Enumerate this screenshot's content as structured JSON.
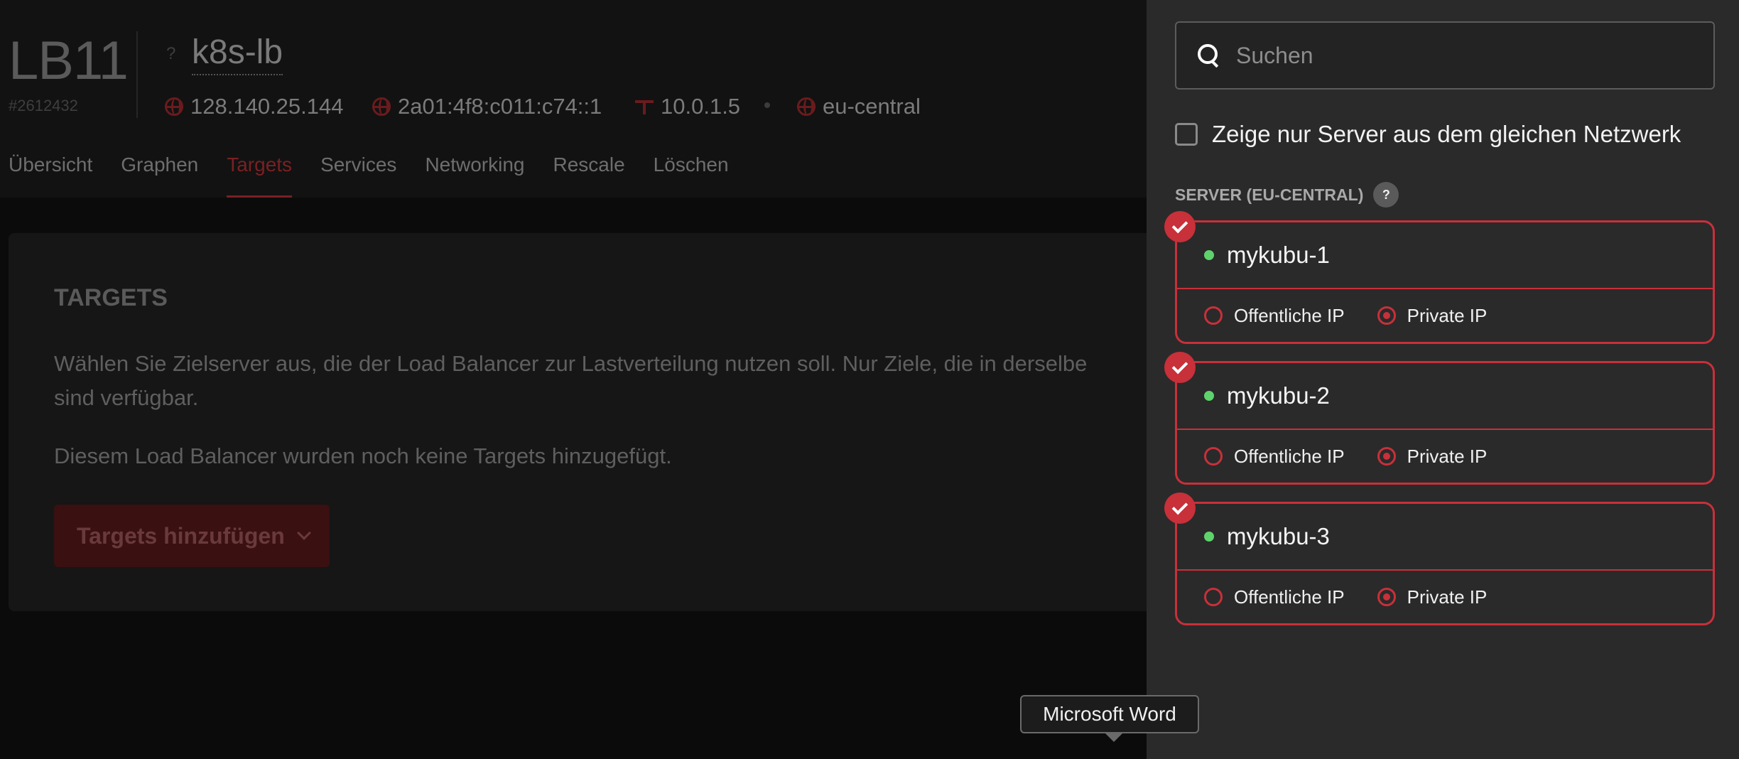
{
  "load_balancer": {
    "type": "LB11",
    "id": "#2612432",
    "help": "?",
    "name": "k8s-lb",
    "ipv4": "128.140.25.144",
    "ipv6": "2a01:4f8:c011:c74::1",
    "private_ip": "10.0.1.5",
    "location": "eu-central"
  },
  "tabs": [
    {
      "label": "Übersicht",
      "active": false
    },
    {
      "label": "Graphen",
      "active": false
    },
    {
      "label": "Targets",
      "active": true
    },
    {
      "label": "Services",
      "active": false
    },
    {
      "label": "Networking",
      "active": false
    },
    {
      "label": "Rescale",
      "active": false
    },
    {
      "label": "Löschen",
      "active": false
    }
  ],
  "targets_card": {
    "title": "TARGETS",
    "description_line1": "Wählen Sie Zielserver aus, die der Load Balancer zur Lastverteilung nutzen soll. Nur Ziele, die in derselbe",
    "description_line2": "sind verfügbar.",
    "empty_text": "Diesem Load Balancer wurden noch keine Targets hinzugefügt.",
    "add_button": "Targets hinzufügen"
  },
  "tooltip": "Microsoft Word",
  "panel": {
    "search_placeholder": "Suchen",
    "network_filter_label": "Zeige nur Server aus dem gleichen Netzwerk",
    "network_filter_checked": false,
    "section_label": "SERVER (EU-CENTRAL)",
    "section_help": "?",
    "servers": [
      {
        "name": "mykubu-1",
        "selected": true,
        "status": "online",
        "public_label": "Offentliche IP",
        "private_label": "Private IP",
        "choice": "private"
      },
      {
        "name": "mykubu-2",
        "selected": true,
        "status": "online",
        "public_label": "Offentliche IP",
        "private_label": "Private IP",
        "choice": "private"
      },
      {
        "name": "mykubu-3",
        "selected": true,
        "status": "online",
        "public_label": "Offentliche IP",
        "private_label": "Private IP",
        "choice": "private"
      }
    ]
  },
  "colors": {
    "accent": "#c8303a",
    "status_online": "#5ed36c",
    "panel_bg": "#2a2a2a"
  }
}
